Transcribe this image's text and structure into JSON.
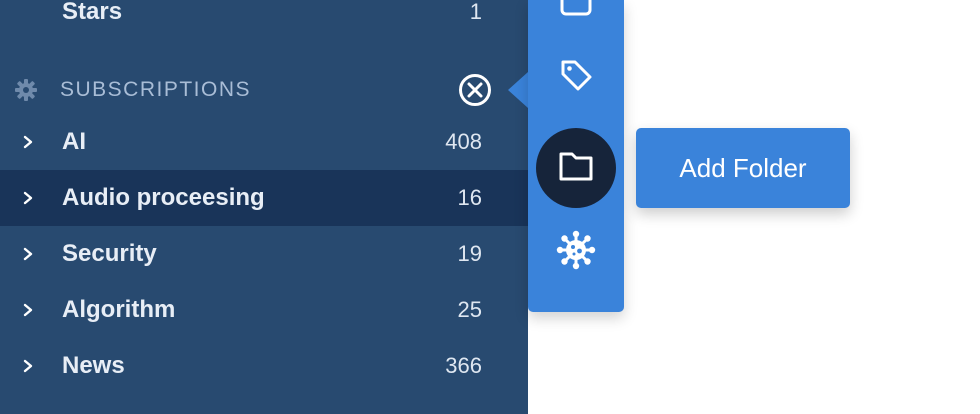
{
  "sidebar": {
    "stars": {
      "label": "Stars",
      "count": "1"
    },
    "subscriptions_title": "SUBSCRIPTIONS",
    "items": [
      {
        "label": "AI",
        "count": "408",
        "selected": false
      },
      {
        "label": "Audio proceesing",
        "count": "16",
        "selected": true
      },
      {
        "label": "Security",
        "count": "19",
        "selected": false
      },
      {
        "label": "Algorithm",
        "count": "25",
        "selected": false
      },
      {
        "label": "News",
        "count": "366",
        "selected": false
      }
    ]
  },
  "toolbar": {
    "tools": [
      "inbox-icon",
      "tag-icon",
      "folder-icon",
      "virus-icon"
    ],
    "active_tool": "folder-icon"
  },
  "tooltip": {
    "label": "Add Folder"
  },
  "colors": {
    "sidebar_bg": "#284a70",
    "selected_bg": "#193459",
    "accent": "#3a83da",
    "active_tool_bg": "#16243a"
  }
}
